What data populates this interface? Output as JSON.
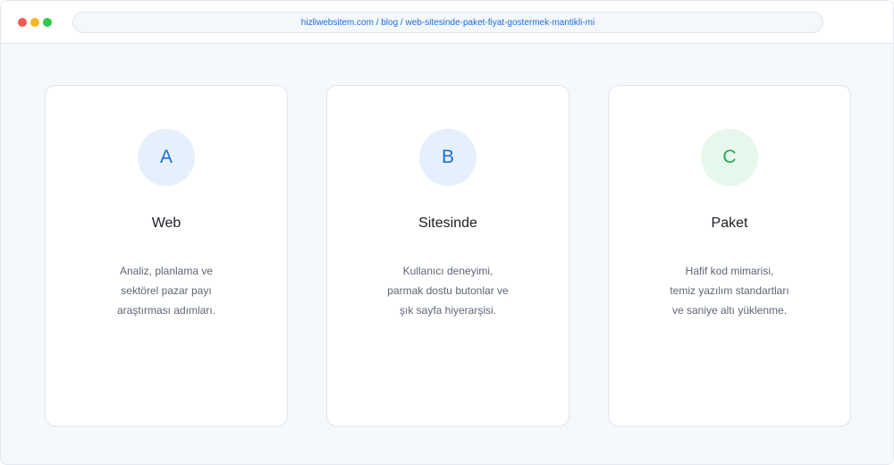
{
  "browser": {
    "url": "hizliwebsitem.com / blog / web-sitesinde-paket-fiyat-gostermek-mantikli-mi",
    "colors": {
      "close": "#f05a4f",
      "minimize": "#f6b728",
      "maximize": "#2fc84a"
    }
  },
  "cards": [
    {
      "letter": "A",
      "title": "Web",
      "desc": [
        "Analiz, planlama ve",
        "sektörel pazar payı",
        "araştırması adımları."
      ],
      "badge_bg": "#e6f0fc",
      "badge_fg": "#1a6fd6"
    },
    {
      "letter": "B",
      "title": "Sitesinde",
      "desc": [
        "Kullanıcı deneyimi,",
        "parmak dostu butonlar ve",
        "şık sayfa hiyerarşisi."
      ],
      "badge_bg": "#e6f0fc",
      "badge_fg": "#1a6fd6"
    },
    {
      "letter": "C",
      "title": "Paket",
      "desc": [
        "Hafif kod mimarisi,",
        "temiz yazılım standartları",
        "ve saniye altı yüklenme."
      ],
      "badge_bg": "#e6f8ec",
      "badge_fg": "#27a653"
    }
  ]
}
